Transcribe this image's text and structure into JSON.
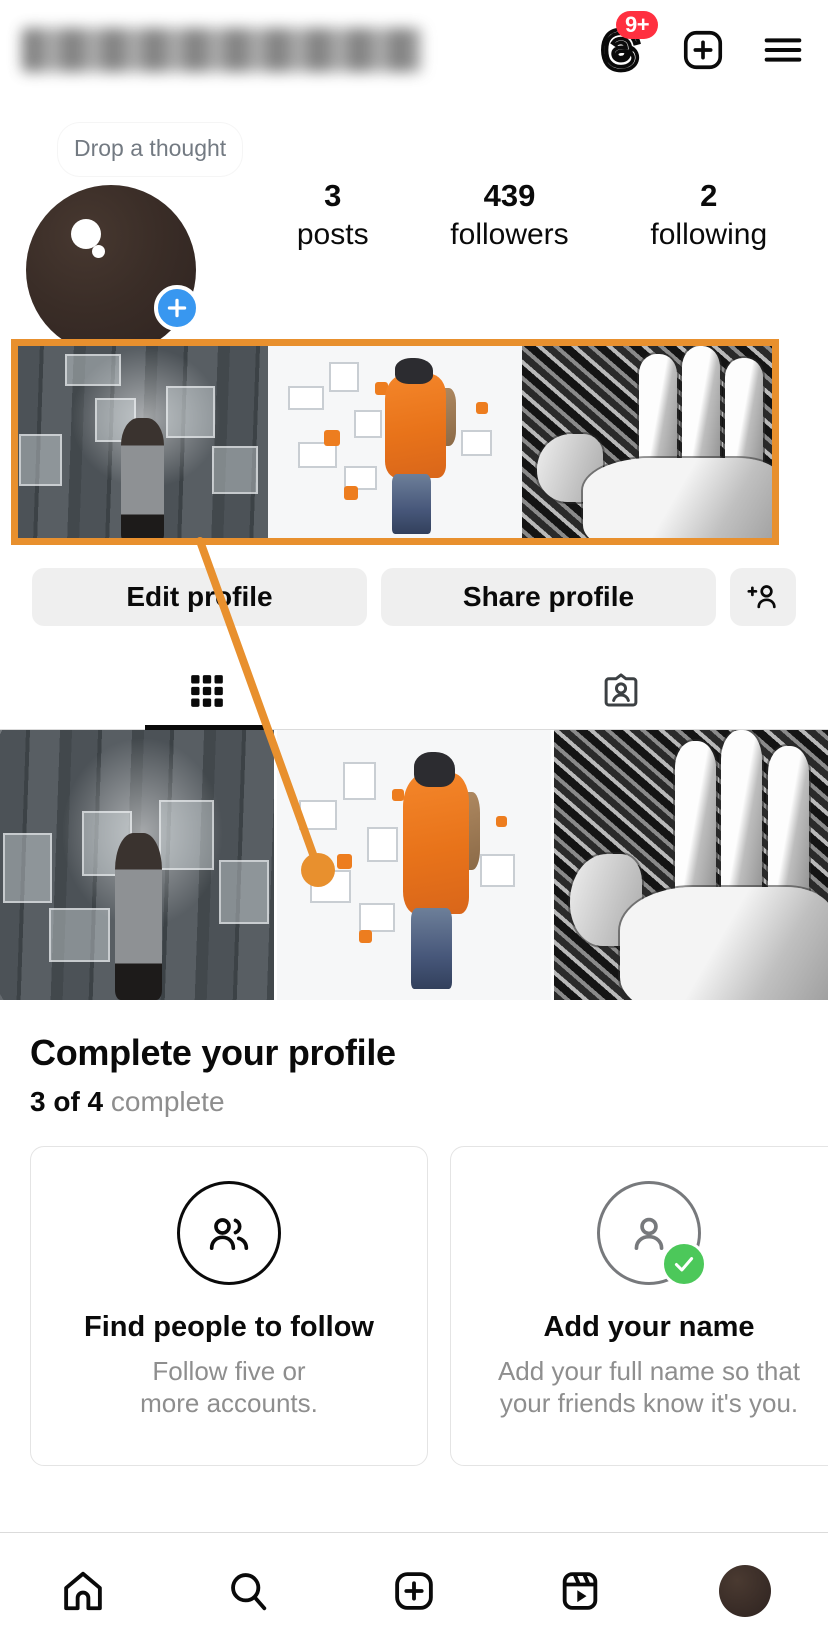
{
  "app": "instagram-profile",
  "topbar": {
    "username_masked": "",
    "threads_icon": "threads-icon",
    "threads_badge": "9+",
    "new_post_icon": "plus-square-icon",
    "menu_icon": "hamburger-menu-icon"
  },
  "profile": {
    "avatar_label": "profile-avatar",
    "note": "Drop a thought",
    "add_badge": "+",
    "stats": [
      {
        "value": "3",
        "label": "posts"
      },
      {
        "value": "439",
        "label": "followers"
      },
      {
        "value": "2",
        "label": "following"
      }
    ]
  },
  "actions": {
    "edit_profile": "Edit profile",
    "share_profile": "Share profile",
    "discover_people_icon": "add-person-icon"
  },
  "tabs": [
    {
      "name": "grid-tab",
      "icon": "grid-icon",
      "active": true
    },
    {
      "name": "tagged-tab",
      "icon": "tagged-user-icon",
      "active": false
    }
  ],
  "grid": {
    "tiles": [
      {
        "alt": "woman-viewing-screens"
      },
      {
        "alt": "person-orange-jacket-vr"
      },
      {
        "alt": "robot-hands-collage"
      }
    ]
  },
  "complete_profile": {
    "title": "Complete your profile",
    "progress_count": "3 of 4",
    "progress_word": "complete",
    "cards": [
      {
        "icon": "two-people-icon",
        "title": "Find people to follow",
        "desc": "Follow five or\nmore accounts.",
        "done": false
      },
      {
        "icon": "person-icon",
        "title": "Add your name",
        "desc": "Add your full name so that\nyour friends know it's you.",
        "done": true,
        "check_icon": "green-check-icon"
      }
    ]
  },
  "bottom_nav": [
    {
      "name": "home-icon",
      "label": "Home"
    },
    {
      "name": "search-icon",
      "label": "Search"
    },
    {
      "name": "create-icon",
      "label": "Create"
    },
    {
      "name": "reels-icon",
      "label": "Reels"
    },
    {
      "name": "profile-avatar-icon",
      "label": "Profile"
    }
  ],
  "annotation": {
    "highlight_color": "#E8902E",
    "target": "post-grid-row-highlight",
    "pointer_from": "122,544",
    "pointer_to": "318,870"
  },
  "colors": {
    "accent_blue": "#3897F0",
    "badge_red": "#FF3040",
    "check_green": "#4CC85A",
    "annotation_orange": "#E8902E",
    "muted_text": "#8E8E8E"
  }
}
